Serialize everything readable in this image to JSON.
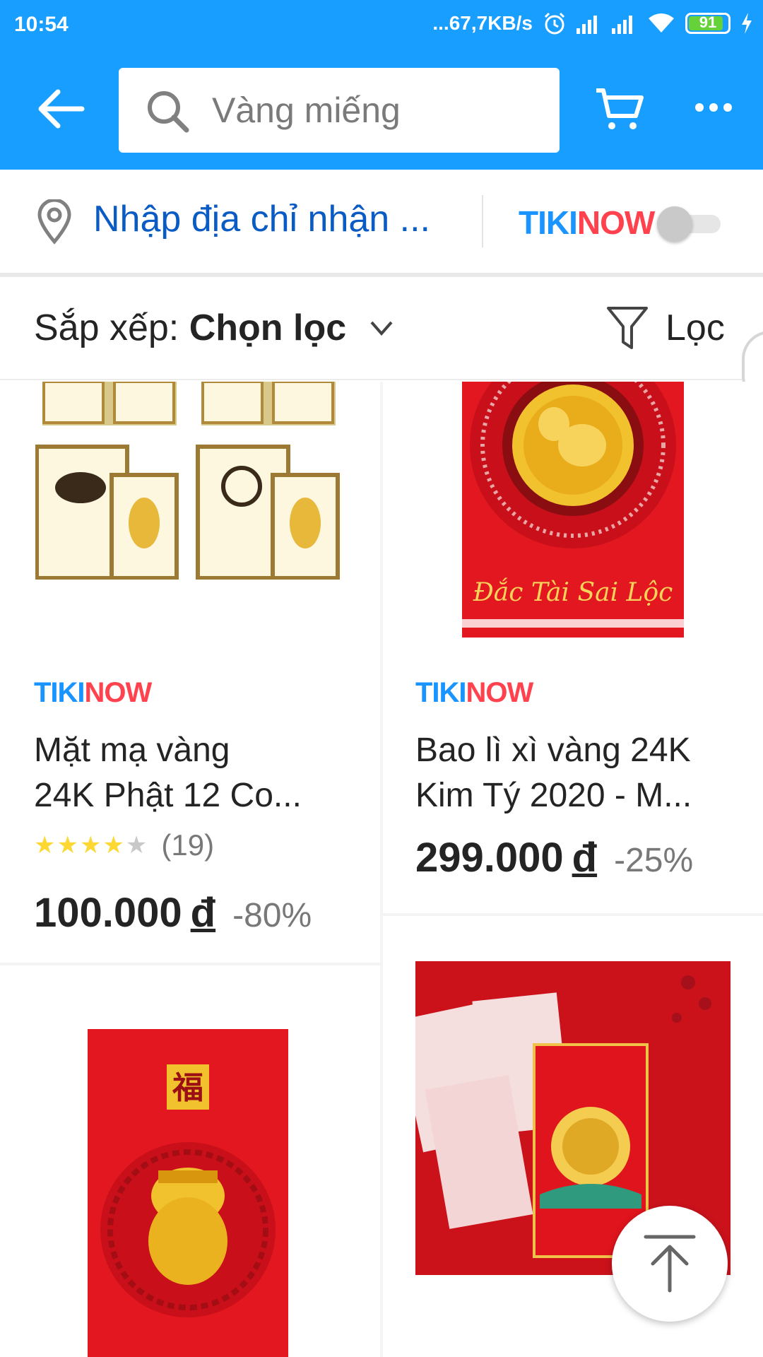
{
  "status_bar": {
    "time": "10:54",
    "network_speed": "...67,7KB/s",
    "battery": "91"
  },
  "header": {
    "search_placeholder": "Vàng miếng"
  },
  "address_bar": {
    "text": "Nhập địa chỉ nhận ...",
    "tikinow_left": "TIKI",
    "tikinow_right": "NOW",
    "tikinow_toggle_on": false
  },
  "sort_bar": {
    "label": "Sắp xếp: ",
    "value": "Chọn lọc",
    "filter_label": "Lọc"
  },
  "products": [
    {
      "badge_left": "TIKI",
      "badge_right": "NOW",
      "name_line1": "Mặt mạ vàng",
      "name_line2": "24K Phật 12 Co...",
      "rating_stars": 4,
      "rating_count": "(19)",
      "price": "100.000",
      "currency": "đ",
      "discount": "-80%"
    },
    {
      "badge_left": "TIKI",
      "badge_right": "NOW",
      "name_line1": "Bao lì xì vàng 24K",
      "name_line2": "Kim Tý 2020 - M...",
      "price": "299.000",
      "currency": "đ",
      "discount": "-25%",
      "image_text": "Đắc Tài Sai Lộc"
    },
    {
      "image_text": "福"
    },
    {}
  ]
}
